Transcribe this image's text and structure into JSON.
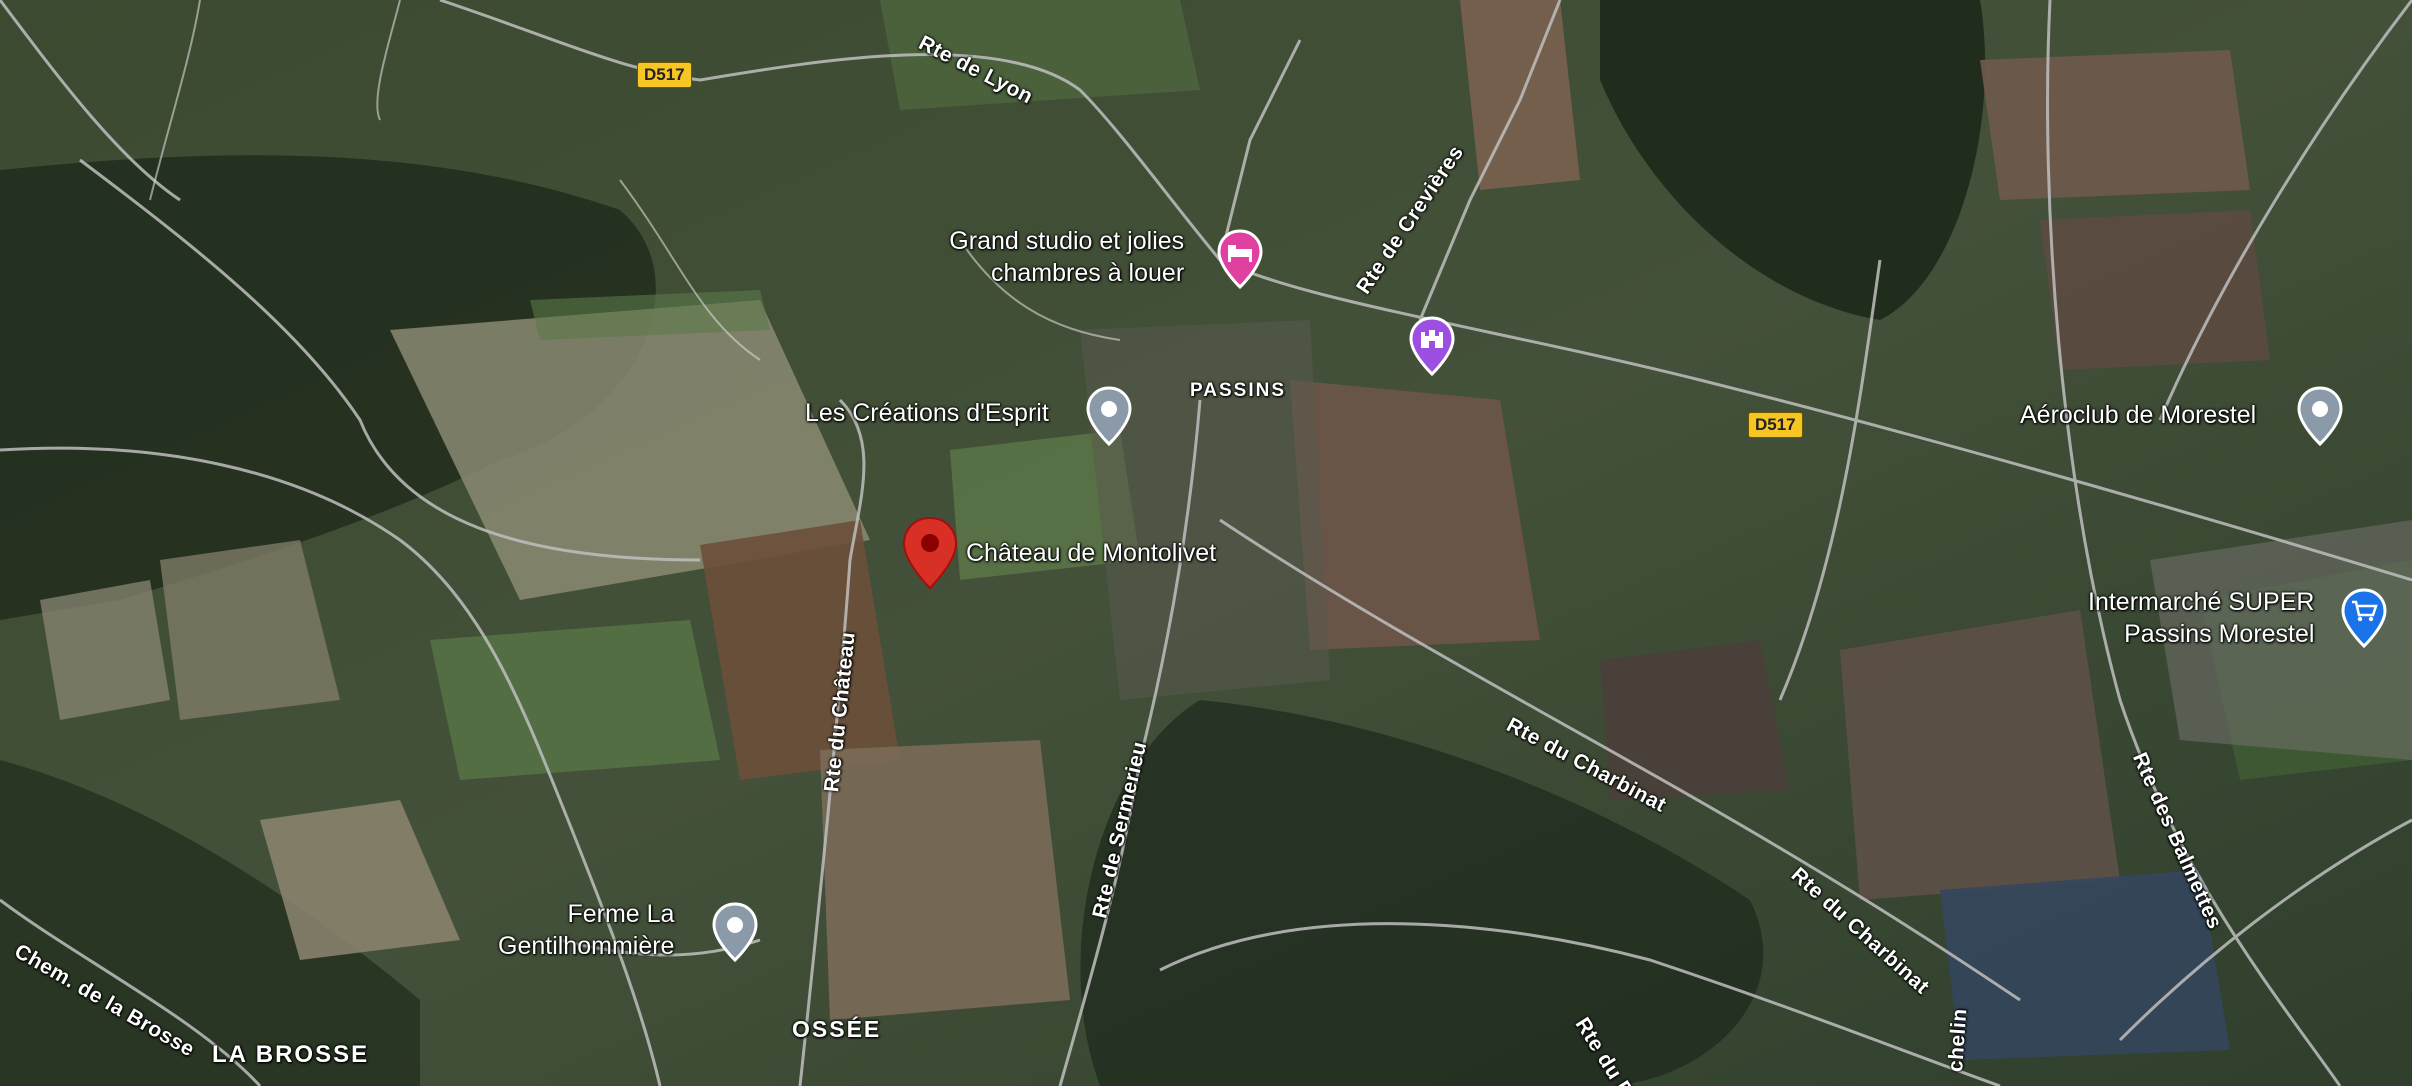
{
  "map": {
    "type": "satellite",
    "shields": [
      {
        "id": "d517-west",
        "text": "D517"
      },
      {
        "id": "d517-east",
        "text": "D517"
      }
    ],
    "roads": [
      {
        "id": "rte-de-lyon",
        "text": "Rte de Lyon"
      },
      {
        "id": "rte-de-crevieres",
        "text": "Rte de Crevières"
      },
      {
        "id": "rte-du-chateau",
        "text": "Rte du Château"
      },
      {
        "id": "rte-de-sermerieu",
        "text": "Rte de Sermerieu"
      },
      {
        "id": "rte-du-charbinat-1",
        "text": "Rte du Charbinat"
      },
      {
        "id": "rte-du-charbinat-2",
        "text": "Rte du Charbinat"
      },
      {
        "id": "rte-des-balmettes",
        "text": "Rte des Balmettes"
      },
      {
        "id": "chem-de-la-brosse",
        "text": "Chem. de la Brosse"
      },
      {
        "id": "rte-du-pit",
        "text": "Rte du Pit d"
      },
      {
        "id": "chemin-partial",
        "text": "chelin"
      }
    ],
    "places": [
      {
        "id": "passins",
        "text": "PASSINS"
      },
      {
        "id": "la-brosse",
        "text": "LA BROSSE"
      },
      {
        "id": "ossee",
        "text": "OSSÉE"
      }
    ],
    "pois": [
      {
        "id": "grand-studio",
        "line1": "Grand studio et jolies",
        "line2": "chambres à louer",
        "icon": "bed-icon",
        "color": "#e040a0"
      },
      {
        "id": "passins-landmark",
        "line1": "",
        "line2": "",
        "icon": "castle-icon",
        "color": "#9c4fe0"
      },
      {
        "id": "creations-esprit",
        "line1": "Les Créations d'Esprit",
        "line2": "",
        "icon": "pin-icon",
        "color": "#8a9aa8"
      },
      {
        "id": "chateau-montolivet",
        "line1": "Château de Montolivet",
        "line2": "",
        "icon": "red-pin-icon",
        "color": "#d93025"
      },
      {
        "id": "aeroclub",
        "line1": "Aéroclub de Morestel",
        "line2": "",
        "icon": "pin-icon",
        "color": "#8a9aa8"
      },
      {
        "id": "intermarche",
        "line1": "Intermarché SUPER",
        "line2": "Passins Morestel",
        "icon": "cart-icon",
        "color": "#1a73e8"
      },
      {
        "id": "ferme",
        "line1": "Ferme La",
        "line2": "Gentilhommière",
        "icon": "pin-icon",
        "color": "#8a9aa8"
      }
    ]
  }
}
